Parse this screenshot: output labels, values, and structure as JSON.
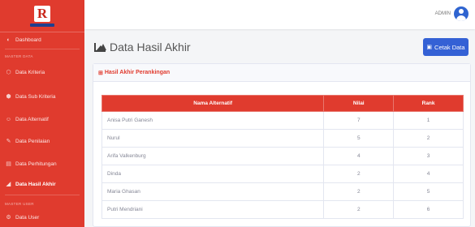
{
  "sidebar": {
    "items": [
      {
        "label": "Dashboard",
        "icon": "gauge-icon"
      },
      {
        "label": "Data Kriteria",
        "icon": "cube-icon"
      },
      {
        "label": "Data Sub Kriteria",
        "icon": "cubes-icon"
      },
      {
        "label": "Data Alternatif",
        "icon": "users-icon"
      },
      {
        "label": "Data Penilaian",
        "icon": "edit-icon"
      },
      {
        "label": "Data Perhitungan",
        "icon": "calculator-icon"
      },
      {
        "label": "Data Hasil Akhir",
        "icon": "chart-area-icon",
        "active": true
      },
      {
        "label": "Data User",
        "icon": "user-cog-icon"
      }
    ],
    "headings": [
      "MASTER DATA",
      "MASTER USER"
    ]
  },
  "topbar": {
    "user_name": "ADMIN"
  },
  "page": {
    "title": "Data Hasil Akhir",
    "print_label": "Cetak Data"
  },
  "card": {
    "title": "Hasil Akhir Perankingan"
  },
  "table": {
    "headers": [
      "Nama Alternatif",
      "Nilai",
      "Rank"
    ],
    "rows": [
      [
        "Anisa Putri Ganesh",
        "7",
        "1"
      ],
      [
        "Nurul",
        "5",
        "2"
      ],
      [
        "Arifa Valkenburg",
        "4",
        "3"
      ],
      [
        "Dinda",
        "2",
        "4"
      ],
      [
        "Maria Ghasan",
        "2",
        "5"
      ],
      [
        "Putri Mendriani",
        "2",
        "6"
      ]
    ]
  },
  "colors": {
    "brand_red": "#e03b2e",
    "primary_blue": "#3461d5"
  }
}
